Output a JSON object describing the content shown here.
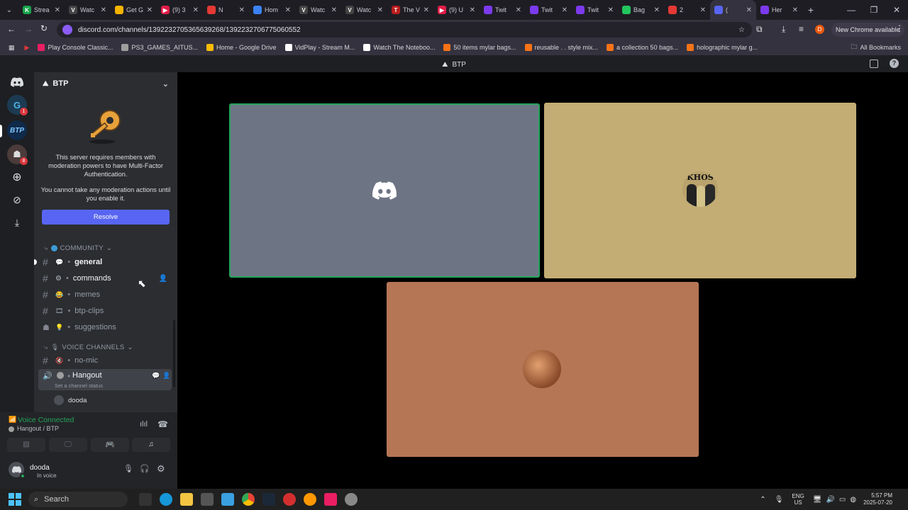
{
  "browser": {
    "tabs": [
      {
        "label": "Strea",
        "fav": "#17a34a",
        "ch": "K"
      },
      {
        "label": "Watc",
        "fav": "#444",
        "ch": "V"
      },
      {
        "label": "Get G",
        "fav": "#f5b400",
        "ch": ""
      },
      {
        "label": "(9) 3",
        "fav": "#e11d48",
        "ch": "▶"
      },
      {
        "label": "N",
        "fav": "#e53935",
        "ch": ""
      },
      {
        "label": "Hom",
        "fav": "#3b82f6",
        "ch": ""
      },
      {
        "label": "Watc",
        "fav": "#444",
        "ch": "V"
      },
      {
        "label": "Watc",
        "fav": "#444",
        "ch": "V"
      },
      {
        "label": "The V",
        "fav": "#b91c1c",
        "ch": "T"
      },
      {
        "label": "(9) U",
        "fav": "#e11d48",
        "ch": "▶"
      },
      {
        "label": "Twit",
        "fav": "#7c3aed",
        "ch": ""
      },
      {
        "label": "Twit",
        "fav": "#7c3aed",
        "ch": ""
      },
      {
        "label": "Twit",
        "fav": "#7c3aed",
        "ch": ""
      },
      {
        "label": "Bag",
        "fav": "#22c55e",
        "ch": ""
      },
      {
        "label": "2",
        "fav": "#e53935",
        "ch": ""
      },
      {
        "label": "(",
        "fav": "#5865f2",
        "ch": ""
      },
      {
        "label": "Her",
        "fav": "#7c3aed",
        "ch": ""
      }
    ],
    "url": "discord.com/channels/1392232705365639268/1392232706775060552",
    "chrome_available": "New Chrome available",
    "profile_initial": "D",
    "bookmarks": [
      {
        "label": "Play Console Classic...",
        "color": "#e91e63"
      },
      {
        "label": "PS3_GAMES_AITUS...",
        "color": "#9e9e9e"
      },
      {
        "label": "Home - Google Drive",
        "color": "#fbbc04"
      },
      {
        "label": "VidPlay - Stream M...",
        "color": "#ffffff"
      },
      {
        "label": "Watch The Noteboo...",
        "color": "#ffffff"
      },
      {
        "label": "50 items mylar bags...",
        "color": "#f97316"
      },
      {
        "label": "reusable . . style mix...",
        "color": "#f97316"
      },
      {
        "label": "a collection 50 bags...",
        "color": "#f97316"
      },
      {
        "label": "holographic mylar g...",
        "color": "#f97316"
      }
    ],
    "all_bookmarks": "All Bookmarks"
  },
  "discord": {
    "window_title": "BTP",
    "server_name": "BTP",
    "mfa_text1": "This server requires members with moderation powers to have Multi-Factor Authentication.",
    "mfa_text2": "You cannot take any moderation actions until you enable it.",
    "resolve": "Resolve",
    "categories": {
      "community": "COMMUNITY",
      "voice": "VOICE CHANNELS"
    },
    "channels": [
      {
        "name": "general",
        "emoji": "💬"
      },
      {
        "name": "commands",
        "emoji": "⚙"
      },
      {
        "name": "memes",
        "emoji": "😂"
      },
      {
        "name": "btp-clips",
        "emoji": "🎞"
      },
      {
        "name": "suggestions",
        "emoji": "💡"
      }
    ],
    "voice_channels": [
      {
        "name": "no-mic"
      },
      {
        "name": "Hangout",
        "status": "Set a channel status"
      }
    ],
    "voice_member": "dooda",
    "voice_connected": "Voice Connected",
    "voice_location": "Hangout / BTP",
    "username": "dooda",
    "user_status": "In voice",
    "guild_badges": [
      "1",
      "8"
    ],
    "tile_label_khos": "KHOS",
    "colors": {
      "tile1": "#6d7585",
      "tile2": "#c3ad74",
      "tile3": "#b57656",
      "blurple": "#5865f2",
      "green": "#23a55a"
    }
  },
  "taskbar": {
    "search": "Search",
    "lang": "ENG",
    "region": "US",
    "time": "5:57 PM",
    "date": "2025-07-20"
  }
}
